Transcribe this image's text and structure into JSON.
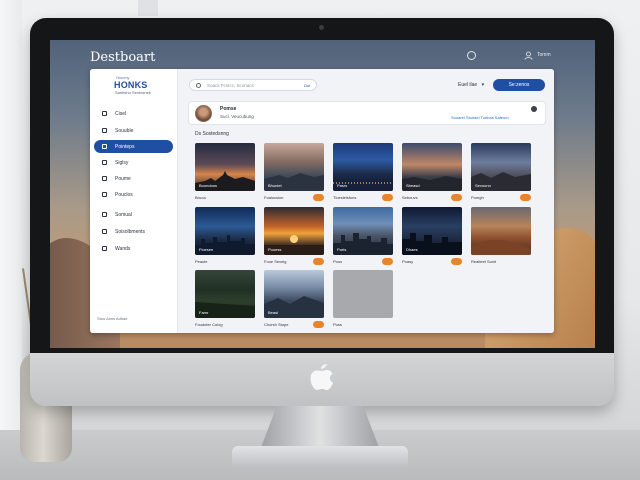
{
  "desktop": {
    "title": "Destboart",
    "user_label": "Tomm"
  },
  "sidebar": {
    "logo_top": "Hrscmy",
    "logo": "HONKS",
    "logo_sub": "Sanbshu Sentosnek",
    "items": [
      {
        "label": "Cisel",
        "icon": "home-icon",
        "active": false
      },
      {
        "label": "Souuble",
        "icon": "folder-icon",
        "active": false
      },
      {
        "label": "Pointeps",
        "icon": "image-icon",
        "active": true
      },
      {
        "label": "Siglsy",
        "icon": "user-icon",
        "active": false
      },
      {
        "label": "Poume",
        "icon": "file-icon",
        "active": false
      },
      {
        "label": "Pouclos",
        "icon": "star-icon",
        "active": false
      },
      {
        "label": "Somual",
        "icon": "grid-icon",
        "active": false
      },
      {
        "label": "Soisolbments",
        "icon": "calendar-icon",
        "active": false
      },
      {
        "label": "Wands",
        "icon": "gear-icon",
        "active": false
      }
    ],
    "footer": "Stoo Alms Adhae"
  },
  "toolbar": {
    "search_placeholder": "Soacs Fcsrcc, Sconacs",
    "search_button": "Oul",
    "filter_label": "Euel ilae",
    "primary_button": "Se:zenos"
  },
  "profile": {
    "name": "Pomse",
    "subtitle": "Sucl. Veucubung",
    "link": "Souarel Storlael Turlbas Sateum"
  },
  "section_title": "Ds Sostedsnng",
  "gallery": [
    {
      "caption": "Bruoa",
      "label": "Boundous",
      "badge": false
    },
    {
      "caption": "Foalocsion",
      "label": "Bhuniet",
      "badge": true
    },
    {
      "caption": "Tloeslelsfons",
      "label": "Pasrs",
      "badge": true
    },
    {
      "caption": "Sebouvs",
      "label": "Sbeasd",
      "badge": true
    },
    {
      "caption": "Pomgh",
      "label": "Sevounn",
      "badge": true
    },
    {
      "caption": "Peaule",
      "label": "Fioesen",
      "badge": false
    },
    {
      "caption": "Foue Seveig",
      "label": "Pouess",
      "badge": true
    },
    {
      "caption": "Pous",
      "label": "Parts",
      "badge": true
    },
    {
      "caption": "Poasy",
      "label": "Dhaes",
      "badge": true
    },
    {
      "caption": "Reatleet Sonit",
      "label": "",
      "badge": false
    },
    {
      "caption": "Foudoter Colog",
      "label": "Famr",
      "badge": false
    },
    {
      "caption": "Chorsh Stupe",
      "label": "Beasl",
      "badge": true
    },
    {
      "caption": "Puss",
      "label": "",
      "badge": false
    }
  ]
}
